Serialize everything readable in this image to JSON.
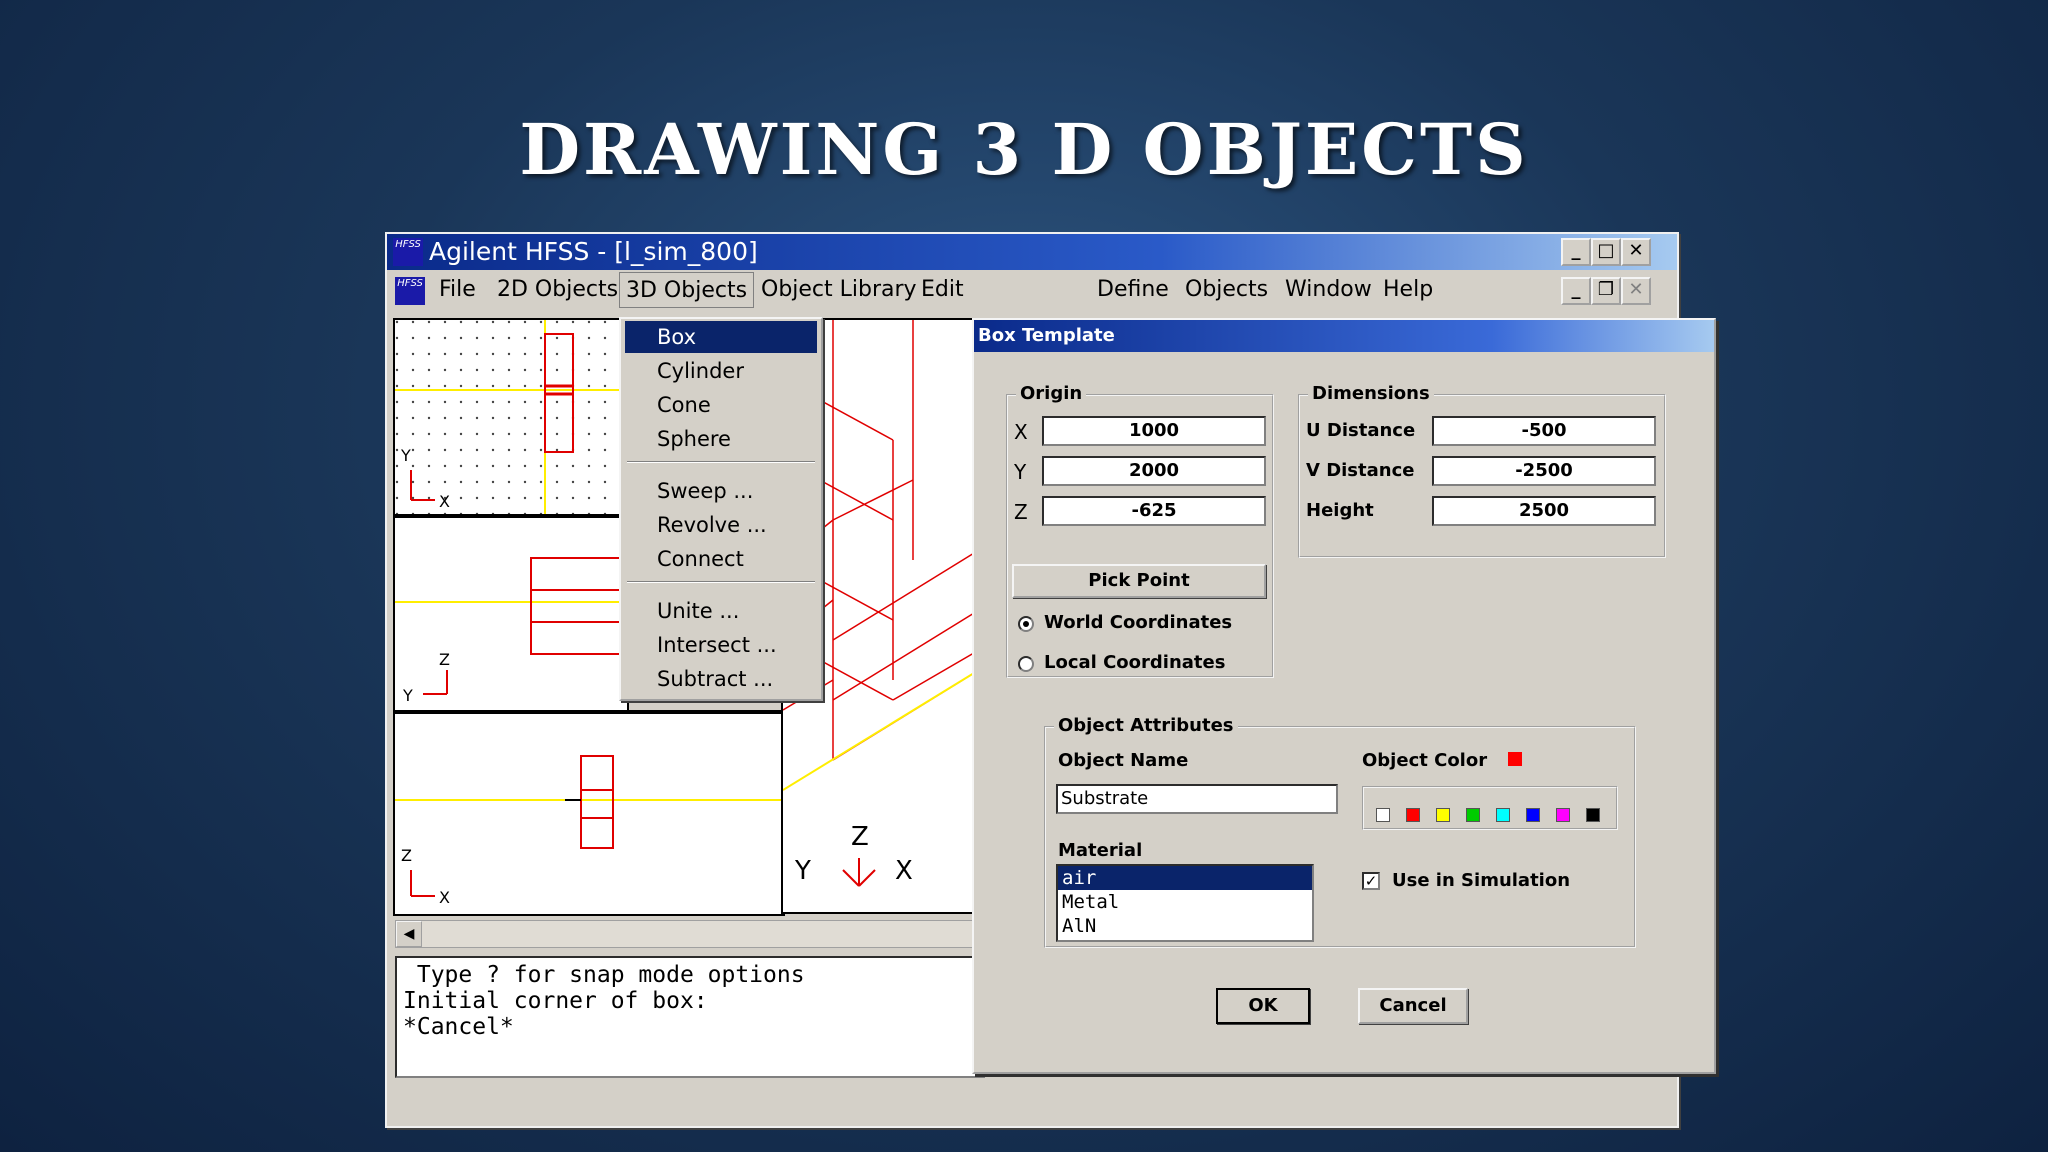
{
  "slide": {
    "title": "DRAWING 3 D OBJECTS"
  },
  "window": {
    "title": "Agilent HFSS - [l_sim_800]",
    "icon_text": "HFSS"
  },
  "menubar": {
    "items": [
      "File",
      "2D Objects",
      "3D Objects",
      "Object Library",
      "Edit",
      "Define",
      "Objects",
      "Window",
      "Help"
    ],
    "open_menu": "3D Objects"
  },
  "dropdown": {
    "items": [
      "Box",
      "Cylinder",
      "Cone",
      "Sphere",
      "Sweep ...",
      "Revolve ...",
      "Connect",
      "Unite ...",
      "Intersect ...",
      "Subtract ..."
    ],
    "selected": "Box"
  },
  "viewports": {
    "top_axes": [
      "Y",
      "X"
    ],
    "front_axes": [
      "Z",
      "Y"
    ],
    "side_axes": [
      "Z",
      "X"
    ],
    "iso_axes": [
      "Z",
      "Y",
      "X"
    ]
  },
  "command_window": {
    "lines": [
      " Type ? for snap mode options",
      "Initial corner of box:",
      "*Cancel*"
    ]
  },
  "dialog": {
    "title": "Box Template",
    "origin": {
      "label": "Origin",
      "x_label": "X",
      "x_value": "1000",
      "y_label": "Y",
      "y_value": "2000",
      "z_label": "Z",
      "z_value": "-625",
      "pick_point": "Pick Point",
      "world_coordinates": "World Coordinates",
      "local_coordinates": "Local Coordinates",
      "selected_coordinates": "World Coordinates"
    },
    "dimensions": {
      "label": "Dimensions",
      "u_label": "U Distance",
      "u_value": "-500",
      "v_label": "V Distance",
      "v_value": "-2500",
      "h_label": "Height",
      "h_value": "2500"
    },
    "attributes": {
      "label": "Object Attributes",
      "name_label": "Object Name",
      "name_value": "Substrate",
      "color_label": "Object Color",
      "current_color": "#ff0000",
      "palette": [
        "#ffffff",
        "#ff0000",
        "#ffff00",
        "#00cc00",
        "#00ffff",
        "#0000ff",
        "#ff00ff",
        "#000000"
      ],
      "material_label": "Material",
      "materials": [
        "air",
        "Metal",
        "AlN"
      ],
      "selected_material": "air",
      "use_in_simulation": "Use in Simulation",
      "use_in_simulation_checked": true
    },
    "ok": "OK",
    "cancel": "Cancel"
  }
}
